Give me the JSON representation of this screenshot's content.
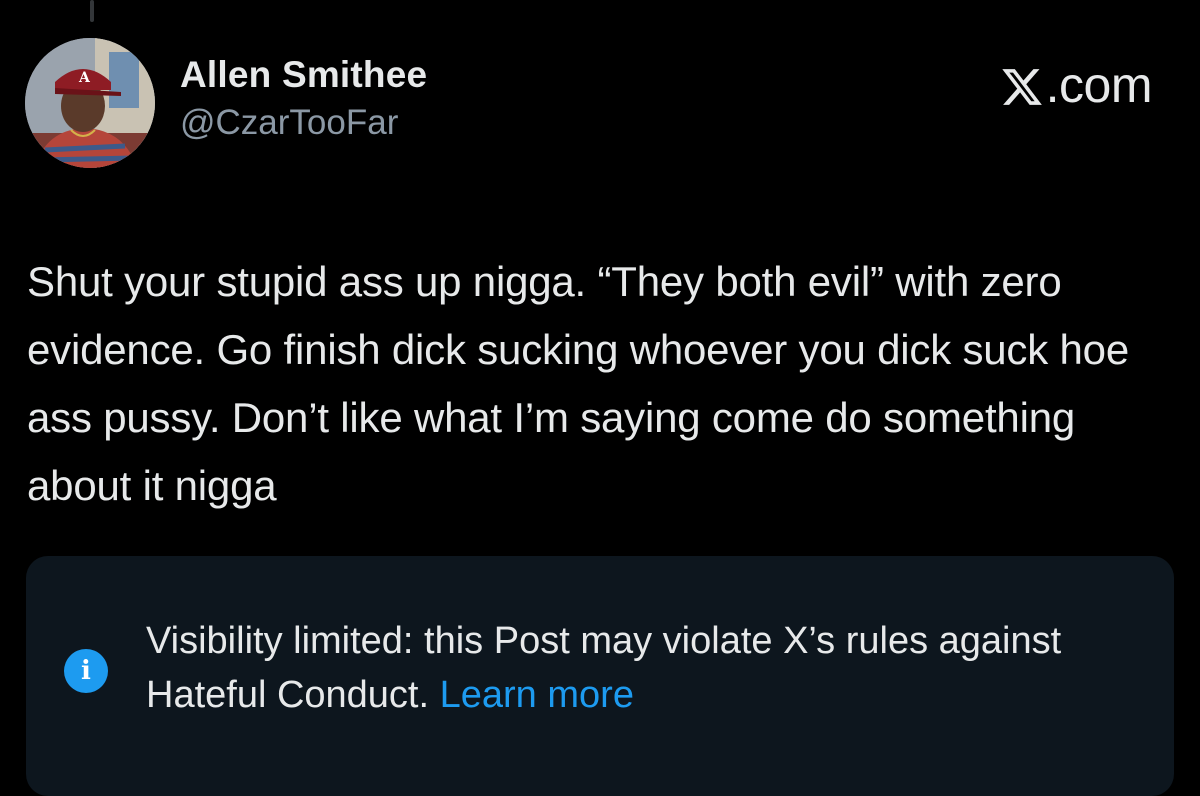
{
  "post": {
    "author": {
      "display_name": "Allen Smithee",
      "handle": "@CzarTooFar"
    },
    "brand_text": ".com",
    "brand_icon": "x-logo-icon",
    "text": "Shut your stupid ass up nigga. “They both evil” with zero evidence. Go finish dick sucking whoever you dick suck hoe ass pussy. Don’t like what I’m saying come do something about it nigga"
  },
  "notice": {
    "icon": "info-icon",
    "icon_glyph": "i",
    "message": "Visibility limited: this Post may violate X’s rules against Hateful Conduct.",
    "link_label": "Learn more"
  },
  "colors": {
    "background": "#000000",
    "text_primary": "#e7e9ea",
    "text_secondary": "#8b98a5",
    "notice_background": "#0d161e",
    "accent": "#1d9bf0"
  }
}
